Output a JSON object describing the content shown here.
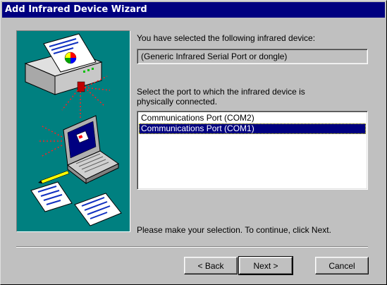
{
  "window": {
    "title": "Add Infrared Device Wizard"
  },
  "main": {
    "selected_intro": "You have selected the following infrared device:",
    "device_name": "(Generic Infrared Serial Port or dongle)",
    "port_prompt_line1": "Select the port to which the infrared device is",
    "port_prompt_line2": "physically connected.",
    "ports": [
      {
        "label": "Communications Port (COM2)",
        "selected": false
      },
      {
        "label": "Communications Port (COM1)",
        "selected": true
      }
    ],
    "instruction": "Please make your selection.  To continue, click Next."
  },
  "buttons": {
    "back_label": "< Back",
    "next_label": "Next >",
    "cancel_label": "Cancel"
  },
  "colors": {
    "titlebar": "#000080",
    "illustration_bg": "#008080",
    "selection": "#000080",
    "dialog_face": "#c0c0c0"
  },
  "icons": {
    "illustration": [
      "printer-icon",
      "laptop-icon",
      "document-icon",
      "pen-icon",
      "infrared-beam-icon"
    ]
  }
}
